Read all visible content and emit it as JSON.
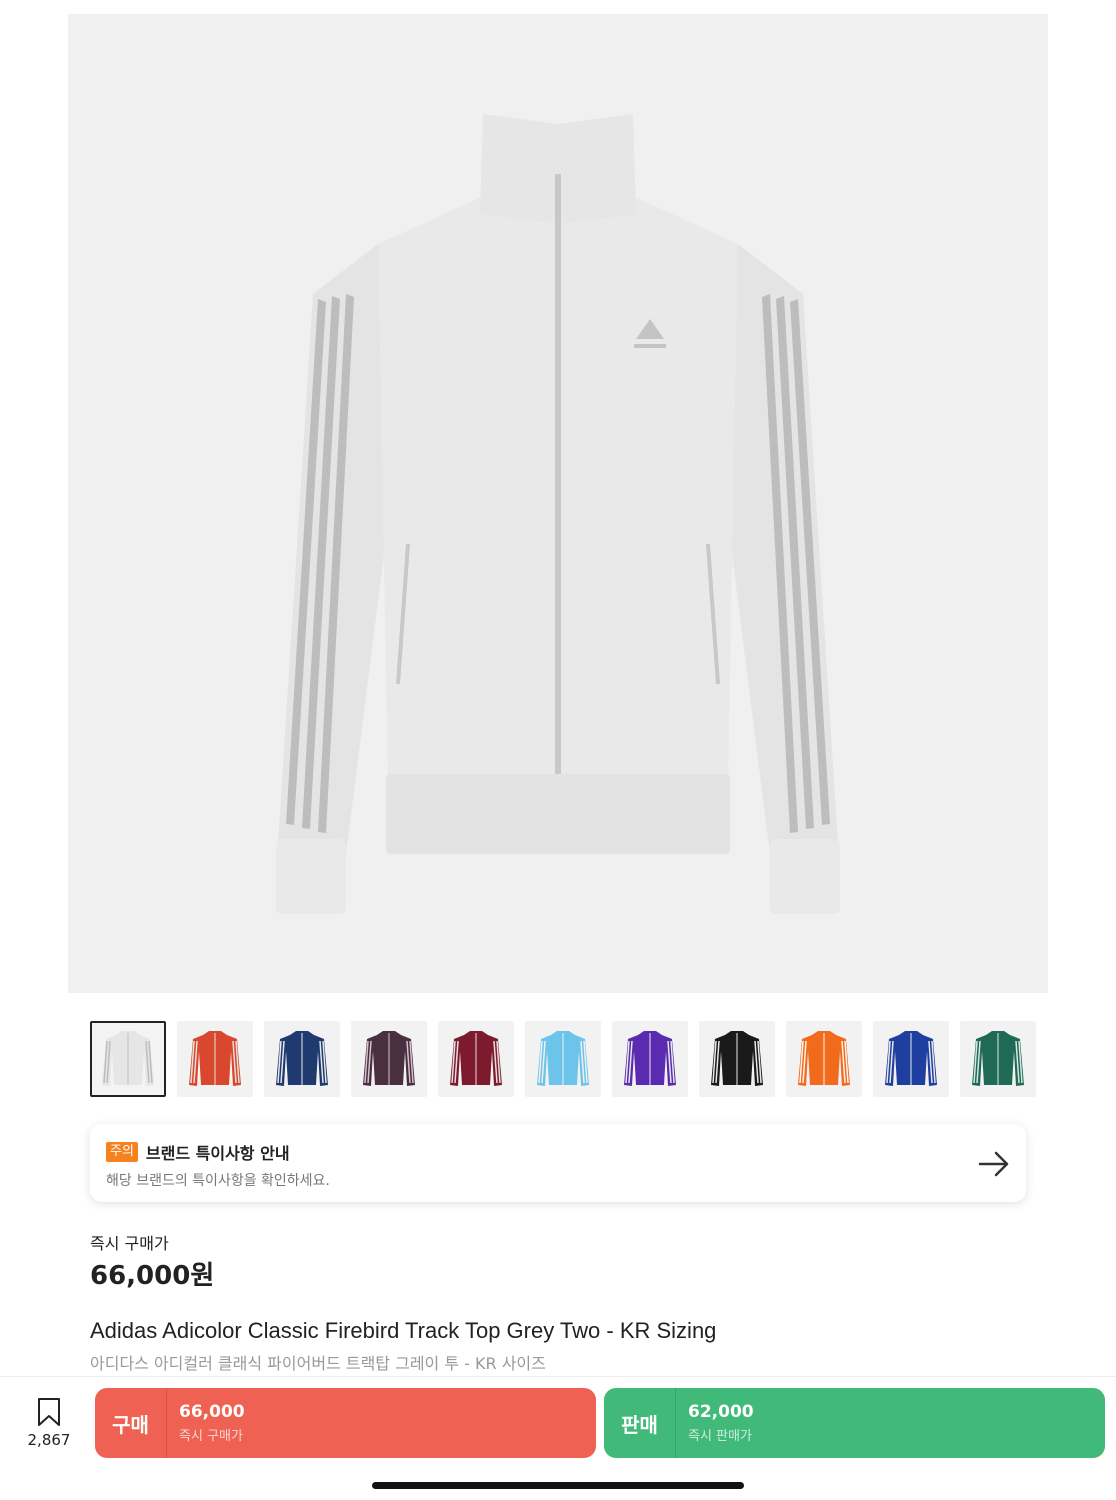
{
  "product": {
    "image_icon": "jacket-image",
    "name": "Adidas Adicolor Classic Firebird Track Top Grey Two - KR Sizing",
    "name_ko": "아디다스 아디컬러 클래식 파이어버드 트랙탑 그레이 투 - KR 사이즈"
  },
  "thumbnails": [
    {
      "color": "#e6e6e6",
      "stripe": "#bdbdbd",
      "selected": true
    },
    {
      "color": "#d9472f",
      "stripe": "#e8e0d8",
      "selected": false
    },
    {
      "color": "#1e3a6e",
      "stripe": "#e8e8e8",
      "selected": false
    },
    {
      "color": "#4a2f3f",
      "stripe": "#d8c0d0",
      "selected": false
    },
    {
      "color": "#7e1a2e",
      "stripe": "#e8e0e0",
      "selected": false
    },
    {
      "color": "#6cc4ea",
      "stripe": "#f0f0f0",
      "selected": false
    },
    {
      "color": "#5a2ab0",
      "stripe": "#e8e8e8",
      "selected": false
    },
    {
      "color": "#1a1a1a",
      "stripe": "#e8e8e8",
      "selected": false
    },
    {
      "color": "#f26a1b",
      "stripe": "#fff5ee",
      "selected": false
    },
    {
      "color": "#1f3fa0",
      "stripe": "#e8e8e8",
      "selected": false
    },
    {
      "color": "#1f6a54",
      "stripe": "#d8e8e0",
      "selected": false
    }
  ],
  "notice": {
    "badge": "주의",
    "title": "브랜드 특이사항 안내",
    "subtitle": "해당 브랜드의 특이사항을 확인하세요.",
    "arrow_icon": "arrow-right-icon",
    "badge_color": "#f5821f"
  },
  "price": {
    "label": "즉시 구매가",
    "value": "66,000원"
  },
  "bottom_bar": {
    "bookmark_icon": "bookmark-icon",
    "bookmark_count": "2,867",
    "buy": {
      "label": "구매",
      "price": "66,000",
      "sub": "즉시 구매가",
      "color": "#ef6253"
    },
    "sell": {
      "label": "판매",
      "price": "62,000",
      "sub": "즉시 판매가",
      "color": "#41b979"
    }
  }
}
